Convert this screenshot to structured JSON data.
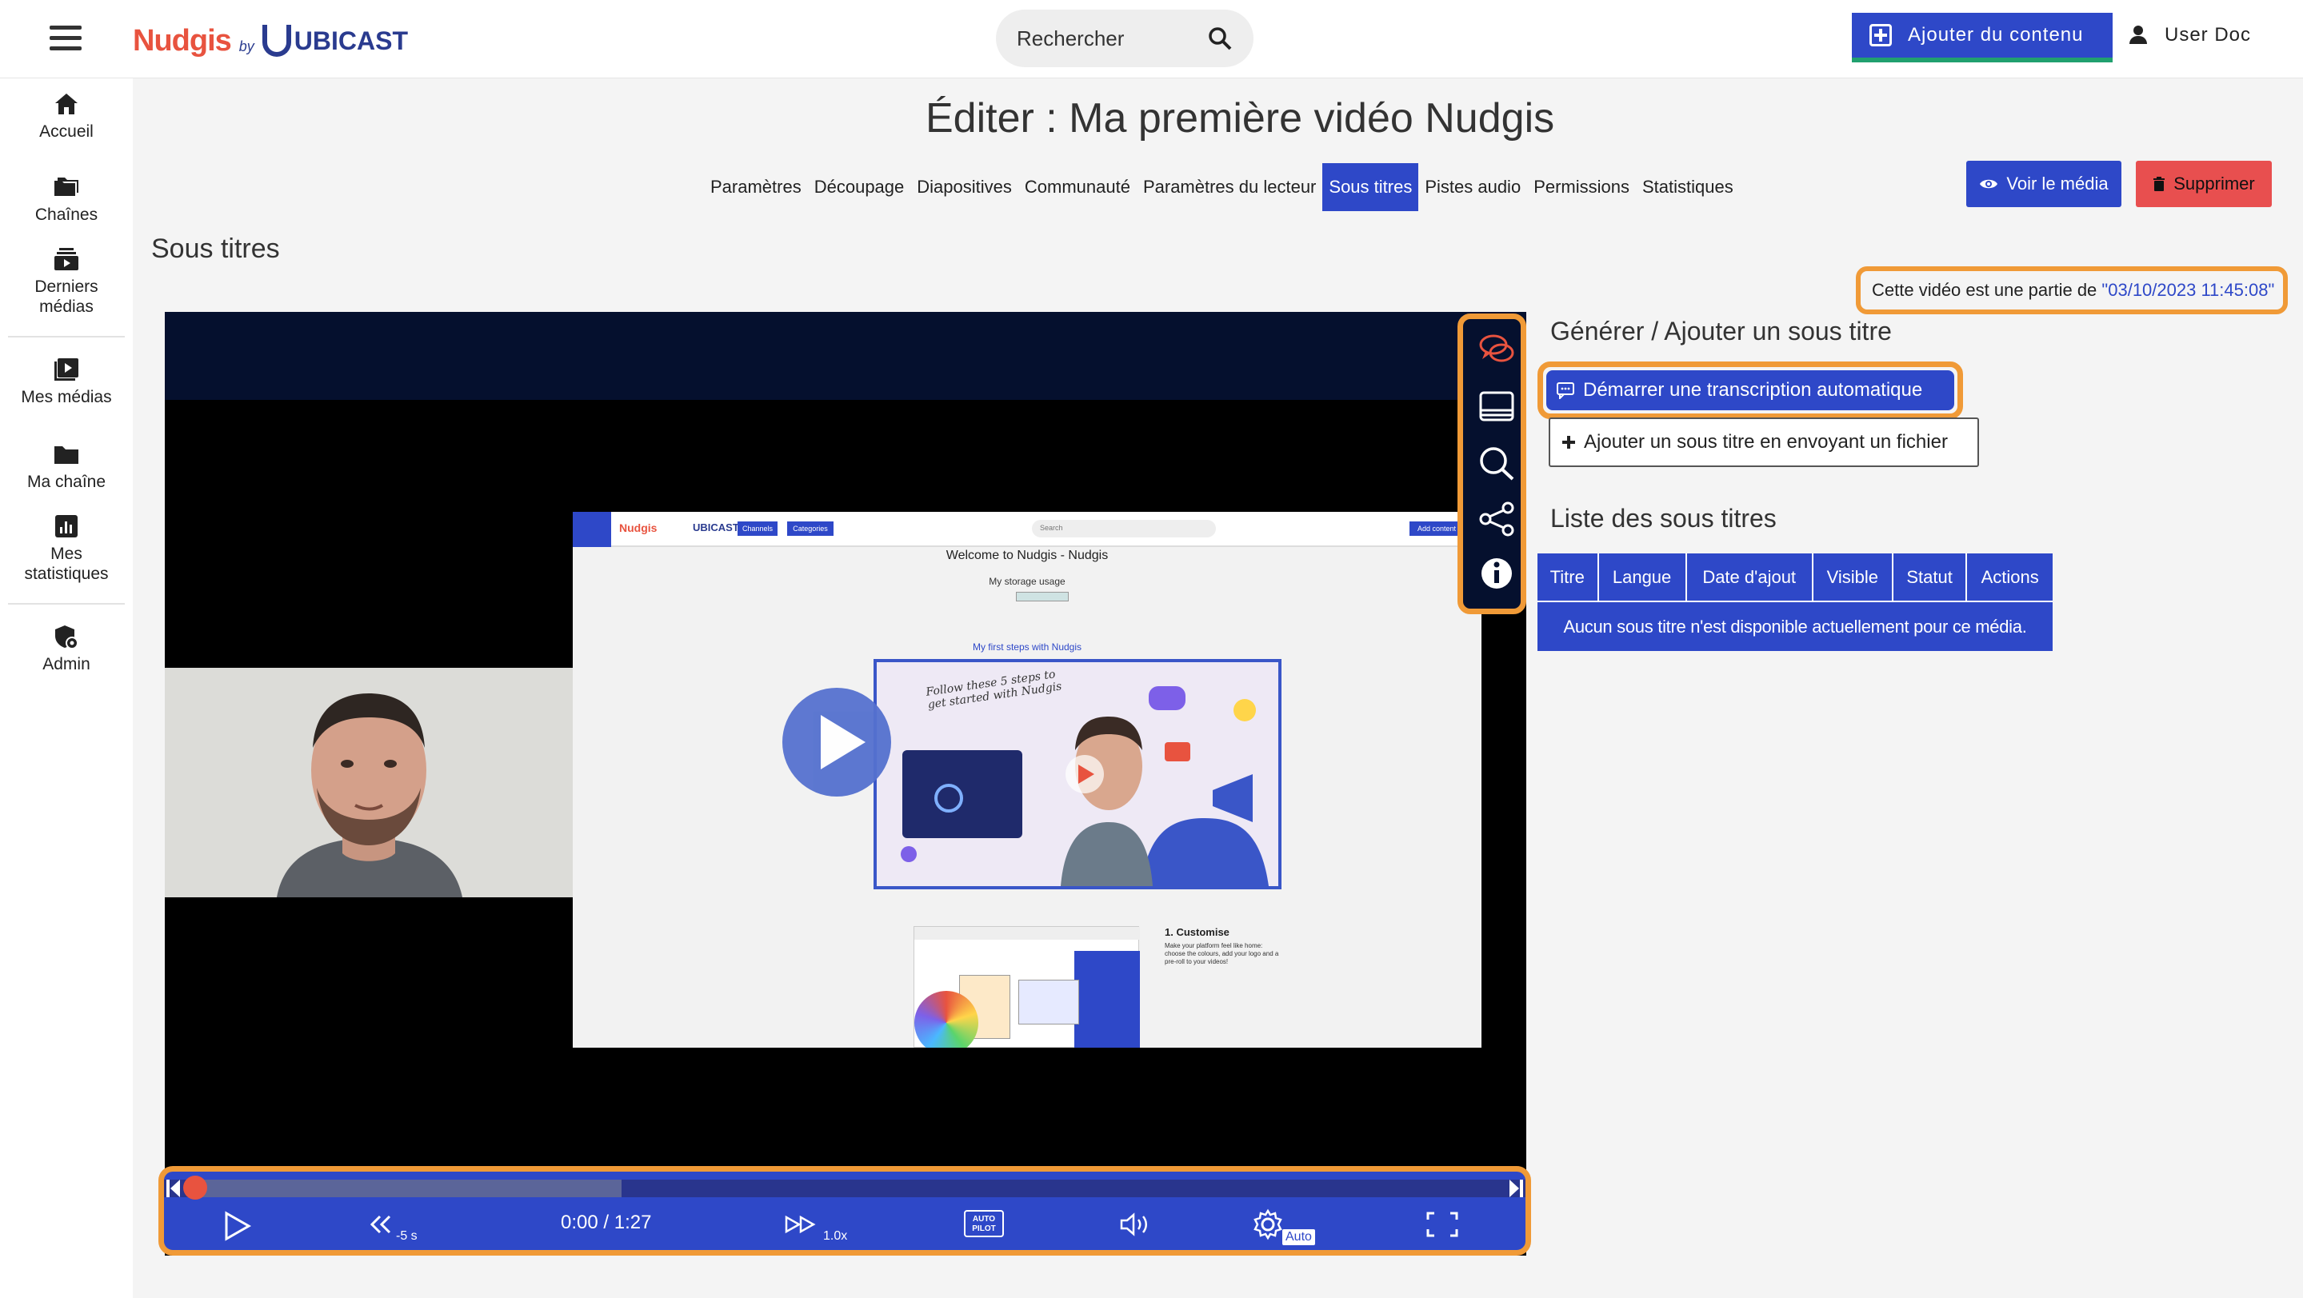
{
  "header": {
    "logo_nudgis": "Nudgis",
    "logo_by": "by",
    "logo_ubicast": "UBICAST",
    "search_placeholder": "Rechercher",
    "add_content_label": "Ajouter du contenu",
    "user_label": "User Doc"
  },
  "sidebar": {
    "items": [
      {
        "label": "Accueil",
        "icon": "home-icon"
      },
      {
        "label": "Chaînes",
        "icon": "folders-icon"
      },
      {
        "label": "Derniers médias",
        "icon": "recent-media-icon"
      },
      {
        "label": "Mes médias",
        "icon": "my-media-icon"
      },
      {
        "label": "Ma chaîne",
        "icon": "folder-icon"
      },
      {
        "label": "Mes statistiques",
        "icon": "stats-icon"
      },
      {
        "label": "Admin",
        "icon": "admin-shield-icon"
      }
    ]
  },
  "page": {
    "title": "Éditer : Ma première vidéo Nudgis",
    "tabs": [
      {
        "label": "Paramètres",
        "active": false
      },
      {
        "label": "Découpage",
        "active": false
      },
      {
        "label": "Diapositives",
        "active": false
      },
      {
        "label": "Communauté",
        "active": false
      },
      {
        "label": "Paramètres du lecteur",
        "active": false
      },
      {
        "label": "Sous titres",
        "active": true
      },
      {
        "label": "Pistes audio",
        "active": false
      },
      {
        "label": "Permissions",
        "active": false
      },
      {
        "label": "Statistiques",
        "active": false
      }
    ],
    "view_media_label": "Voir le média",
    "delete_label": "Supprimer",
    "section_title": "Sous titres",
    "part_notice_text": "Cette vidéo est une partie de ",
    "part_notice_date": "\"03/10/2023 11:45:08\""
  },
  "player": {
    "time": "0:00 / 1:27",
    "rewind_label": "-5 s",
    "speed_label": "1.0x",
    "autopilot_label": "AUTO PILOT",
    "quality_label": "Auto",
    "progress_fraction": 0,
    "slide": {
      "welcome": "Welcome to Nudgis - Nudgis",
      "storage": "My storage usage",
      "first_steps": "My first steps with Nudgis",
      "follow_steps": "Follow these 5 steps to get started with Nudgis",
      "customise_title": "1. Customise",
      "customise_text": "Make your platform feel like home: choose the colours, add your logo and a pre-roll to your videos!",
      "search": "Search",
      "channels": "Channels",
      "categories": "Categories",
      "add_content": "Add content"
    }
  },
  "subtitles": {
    "generate_title": "Générer / Ajouter un sous titre",
    "auto_transcription_label": "Démarrer une transcription automatique",
    "upload_file_label": "Ajouter un sous titre en envoyant un fichier",
    "list_title": "Liste des sous titres",
    "columns": [
      "Titre",
      "Langue",
      "Date d'ajout",
      "Visible",
      "Statut",
      "Actions"
    ],
    "empty_message": "Aucun sous titre n'est disponible actuellement pour ce média."
  },
  "colors": {
    "brand_blue": "#2e48c8",
    "brand_red": "#e8533f",
    "highlight_orange": "#f09a37",
    "delete_red": "#e84f4f"
  }
}
